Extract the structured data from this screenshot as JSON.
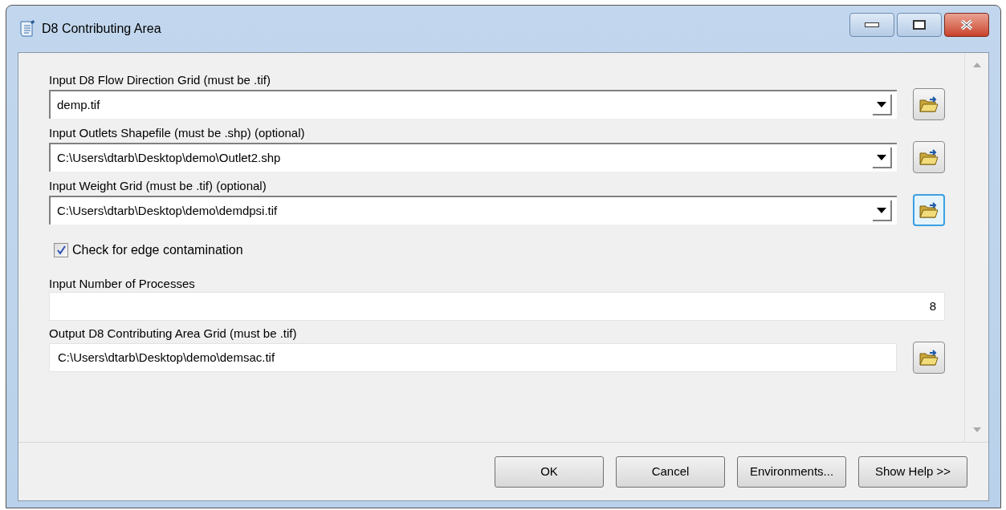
{
  "window": {
    "title": "D8 Contributing Area"
  },
  "parameters": [
    {
      "kind": "combo",
      "label": "Input D8 Flow Direction Grid (must be .tif)",
      "value": "demp.tif",
      "browse_focused": false
    },
    {
      "kind": "combo",
      "label": "Input Outlets Shapefile (must be .shp) (optional)",
      "value": "C:\\Users\\dtarb\\Desktop\\demo\\Outlet2.shp",
      "browse_focused": false
    },
    {
      "kind": "combo",
      "label": "Input Weight Grid (must be .tif) (optional)",
      "value": "C:\\Users\\dtarb\\Desktop\\demo\\demdpsi.tif",
      "browse_focused": true
    },
    {
      "kind": "checkbox",
      "label": "Check for edge contamination",
      "checked": true
    },
    {
      "kind": "number",
      "label": "Input Number of Processes",
      "value": "8"
    },
    {
      "kind": "file",
      "label": "Output D8 Contributing Area Grid (must be .tif)",
      "value": "C:\\Users\\dtarb\\Desktop\\demo\\demsac.tif",
      "browse_focused": false
    }
  ],
  "buttons": [
    "OK",
    "Cancel",
    "Environments...",
    "Show Help >>"
  ]
}
